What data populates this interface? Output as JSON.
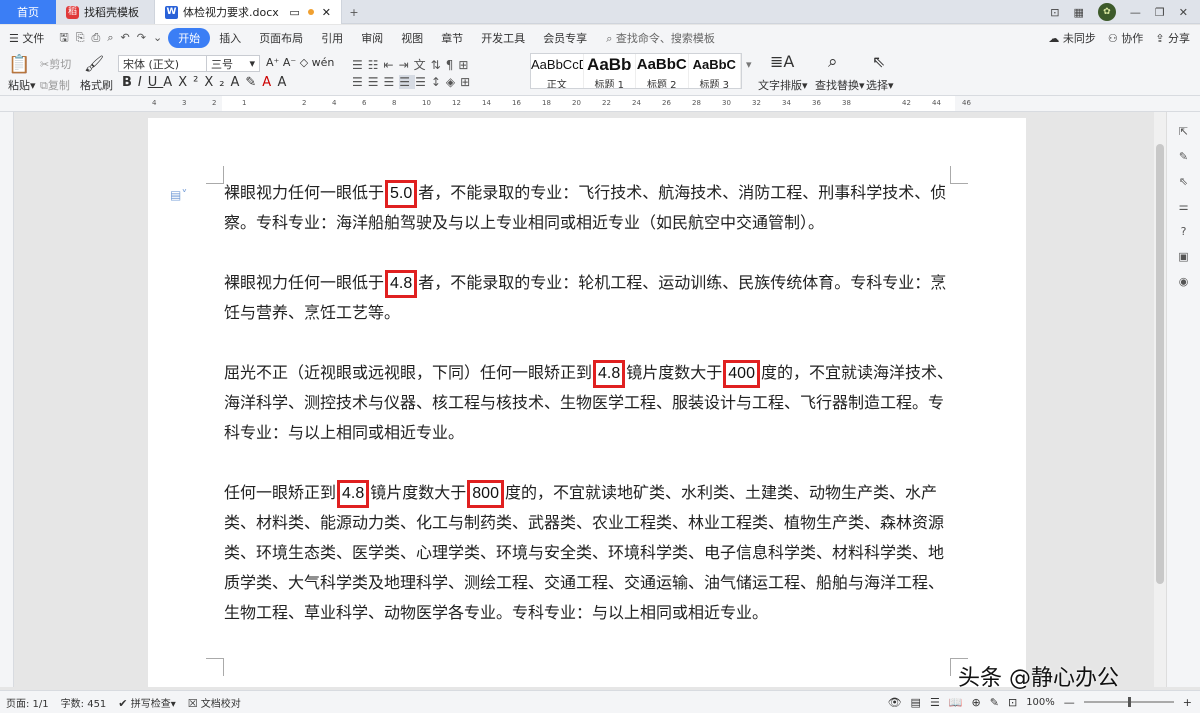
{
  "tabs": {
    "home": "首页",
    "template": "找稻壳模板",
    "doc": "体检视力要求.docx"
  },
  "menu": {
    "file": "文件",
    "items": [
      "开始",
      "插入",
      "页面布局",
      "引用",
      "审阅",
      "视图",
      "章节",
      "开发工具",
      "会员专享"
    ],
    "search": "查找命令、搜索模板",
    "sync": "未同步",
    "collab": "协作",
    "share": "分享"
  },
  "ribbon": {
    "paste": "粘贴",
    "cut": "剪切",
    "copy": "复制",
    "format_painter": "格式刷",
    "font": "宋体 (正文)",
    "size": "三号",
    "styles": [
      {
        "preview": "AaBbCcD",
        "label": "正文"
      },
      {
        "preview": "AaBb",
        "label": "标题 1"
      },
      {
        "preview": "AaBbC",
        "label": "标题 2"
      },
      {
        "preview": "AaBbC",
        "label": "标题 3"
      }
    ],
    "text_layout": "文字排版",
    "find_replace": "查找替换",
    "select": "选择"
  },
  "ruler_ticks": [
    "4",
    "3",
    "2",
    "1",
    "",
    "2",
    "4",
    "6",
    "8",
    "10",
    "12",
    "14",
    "16",
    "18",
    "20",
    "22",
    "24",
    "26",
    "28",
    "30",
    "32",
    "34",
    "36",
    "38",
    "",
    "42",
    "44",
    "46"
  ],
  "document": {
    "paragraphs": [
      {
        "segments": [
          {
            "t": "裸眼视力任何一眼低于"
          },
          {
            "t": "5.0",
            "hl": true
          },
          {
            "t": "者，不能录取的专业：飞行技术、航海技术、消防工程、刑事科学技术、侦察。专科专业：海洋船舶驾驶及与以上专业相同或相近专业（如民航空中交通管制）。"
          }
        ]
      },
      {
        "segments": [
          {
            "t": "裸眼视力任何一眼低于"
          },
          {
            "t": "4.8",
            "hl": true
          },
          {
            "t": "者，不能录取的专业：轮机工程、运动训练、民族传统体育。专科专业：烹饪与营养、烹饪工艺等。"
          }
        ]
      },
      {
        "segments": [
          {
            "t": "屈光不正（近视眼或远视眼，下同）任何一眼矫正到"
          },
          {
            "t": "4.8",
            "hl": true
          },
          {
            "t": "镜片度数大于"
          },
          {
            "t": "400",
            "hl": true
          },
          {
            "t": "度的，不宜就读海洋技术、海洋科学、测控技术与仪器、核工程与核技术、生物医学工程、服装设计与工程、飞行器制造工程。专科专业：与以上相同或相近专业。"
          }
        ]
      },
      {
        "segments": [
          {
            "t": "任何一眼矫正到"
          },
          {
            "t": "4.8",
            "hl": true
          },
          {
            "t": "镜片度数大于"
          },
          {
            "t": "800",
            "hl": true
          },
          {
            "t": "度的，不宜就读地矿类、水利类、土建类、动物生产类、水产类、材料类、能源动力类、化工与制药类、武器类、农业工程类、林业工程类、植物生产类、森林资源类、环境生态类、医学类、心理学类、环境与安全类、环境科学类、电子信息科学类、材料科学类、地质学类、大气科学类及地理科学、测绘工程、交通工程、交通运输、油气储运工程、船舶与海洋工程、生物工程、草业科学、动物医学各专业。专科专业：与以上相同或相近专业。"
          }
        ]
      }
    ]
  },
  "status": {
    "page": "页面: 1/1",
    "words": "字数: 451",
    "spell": "拼写检查",
    "proof": "文档校对",
    "zoom": "100%"
  },
  "watermark": "头条 @静心办公"
}
